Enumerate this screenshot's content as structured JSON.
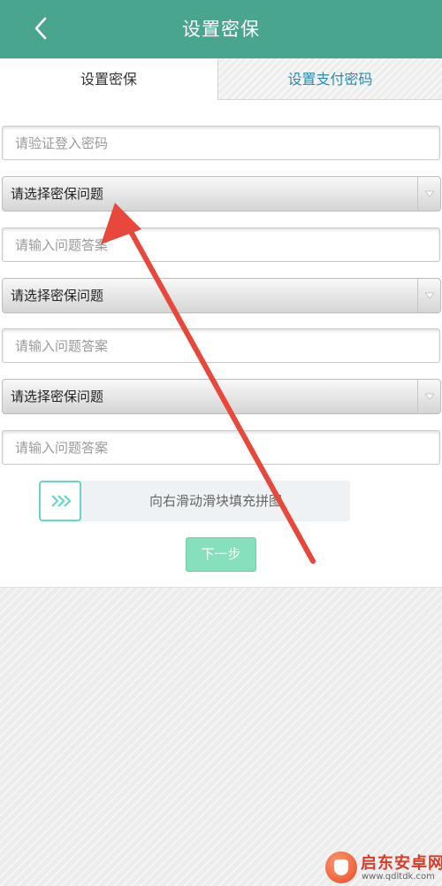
{
  "header": {
    "title": "设置密保"
  },
  "tabs": [
    {
      "label": "设置密保",
      "active": true
    },
    {
      "label": "设置支付密码",
      "active": false
    }
  ],
  "form": {
    "login_password_placeholder": "请验证登入密码",
    "questions": [
      {
        "select_label": "请选择密保问题",
        "answer_placeholder": "请输入问题答案"
      },
      {
        "select_label": "请选择密保问题",
        "answer_placeholder": "请输入问题答案"
      },
      {
        "select_label": "请选择密保问题",
        "answer_placeholder": "请输入问题答案"
      }
    ]
  },
  "slider": {
    "label": "向右滑动滑块填充拼图"
  },
  "next_button": {
    "label": "下一步"
  },
  "watermark": {
    "title": "启东安卓网",
    "url": "www.qdltdk.com"
  },
  "colors": {
    "header": "#4aa58f",
    "tab_inactive_text": "#2a8bb0",
    "slider_handle_border": "#66d6c6",
    "next_button": "#86dfbd",
    "annotation_arrow": "#e8483b"
  }
}
